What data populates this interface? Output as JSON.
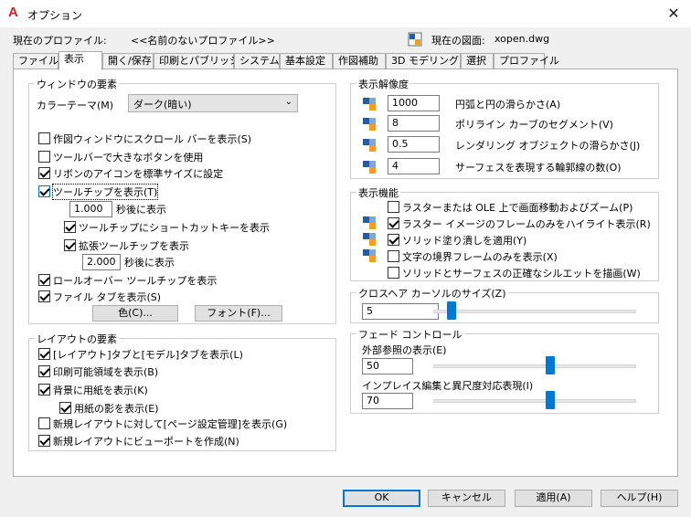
{
  "window": {
    "title": "オプション",
    "app_icon": "A",
    "close_glyph": "✕"
  },
  "profile": {
    "current_profile_label": "現在のプロファイル:",
    "current_profile_value": "<<名前のないプロファイル>>",
    "current_drawing_label": "現在の図面:",
    "current_drawing_value": "xopen.dwg"
  },
  "tabs": [
    {
      "label": "ファイル"
    },
    {
      "label": "表示"
    },
    {
      "label": "開く/保存"
    },
    {
      "label": "印刷とパブリッシュ"
    },
    {
      "label": "システム"
    },
    {
      "label": "基本設定"
    },
    {
      "label": "作図補助"
    },
    {
      "label": "3D モデリング"
    },
    {
      "label": "選択"
    },
    {
      "label": "プロファイル"
    }
  ],
  "window_elements": {
    "group_label": "ウィンドウの要素",
    "color_theme_label": "カラーテーマ(M)",
    "color_theme_value": "ダーク(暗い)",
    "scrollbars": "作図ウィンドウにスクロール バーを表示(S)",
    "large_buttons": "ツールバーで大きなボタンを使用",
    "ribbon_icons": "リボンのアイコンを標準サイズに設定",
    "show_tooltips": "ツールチップを表示(T)",
    "tooltip_delay_value": "1.000",
    "tooltip_delay_suffix": "秒後に表示",
    "shortcut_keys": "ツールチップにショートカットキーを表示",
    "extended_tooltips": "拡張ツールチップを表示",
    "extended_delay_value": "2.000",
    "extended_delay_suffix": "秒後に表示",
    "rollover": "ロールオーバー ツールチップを表示",
    "file_tabs": "ファイル タブを表示(S)",
    "color_button": "色(C)...",
    "font_button": "フォント(F)..."
  },
  "layout_elements": {
    "group_label": "レイアウトの要素",
    "layout_model_tabs": "[レイアウト]タブと[モデル]タブを表示(L)",
    "printable_area": "印刷可能領域を表示(B)",
    "paper_background": "背景に用紙を表示(K)",
    "paper_shadow": "用紙の影を表示(E)",
    "page_setup_manager": "新規レイアウトに対して[ページ設定管理]を表示(G)",
    "create_viewport": "新規レイアウトにビューポートを作成(N)"
  },
  "display_resolution": {
    "group_label": "表示解像度",
    "items": [
      {
        "value": "1000",
        "label": "円弧と円の滑らかさ(A)"
      },
      {
        "value": "8",
        "label": "ポリライン カーブのセグメント(V)"
      },
      {
        "value": "0.5",
        "label": "レンダリング オブジェクトの滑らかさ(J)"
      },
      {
        "value": "4",
        "label": "サーフェスを表現する輪郭線の数(O)"
      }
    ]
  },
  "display_performance": {
    "group_label": "表示機能",
    "items": [
      {
        "label": "ラスターまたは OLE 上で画面移動およびズーム(P)",
        "checked": false
      },
      {
        "label": "ラスター イメージのフレームのみをハイライト表示(R)",
        "checked": true
      },
      {
        "label": "ソリッド塗り潰しを適用(Y)",
        "checked": true
      },
      {
        "label": "文字の境界フレームのみを表示(X)",
        "checked": false
      },
      {
        "label": "ソリッドとサーフェスの正確なシルエットを描画(W)",
        "checked": false
      }
    ]
  },
  "crosshair": {
    "group_label": "クロスヘア カーソルのサイズ(Z)",
    "value": "5",
    "fraction": 0.05
  },
  "fade_control": {
    "group_label": "フェード コントロール",
    "xref_label": "外部参照の表示(E)",
    "xref_value": "50",
    "xref_fraction": 0.56,
    "inplace_label": "インプレイス編集と異尺度対応表現(I)",
    "inplace_value": "70",
    "inplace_fraction": 0.56
  },
  "buttons": {
    "ok": "OK",
    "cancel": "キャンセル",
    "apply": "適用(A)",
    "help": "ヘルプ(H)"
  },
  "colors": {
    "accent": "#0078d7",
    "app_red": "#d0202a"
  }
}
